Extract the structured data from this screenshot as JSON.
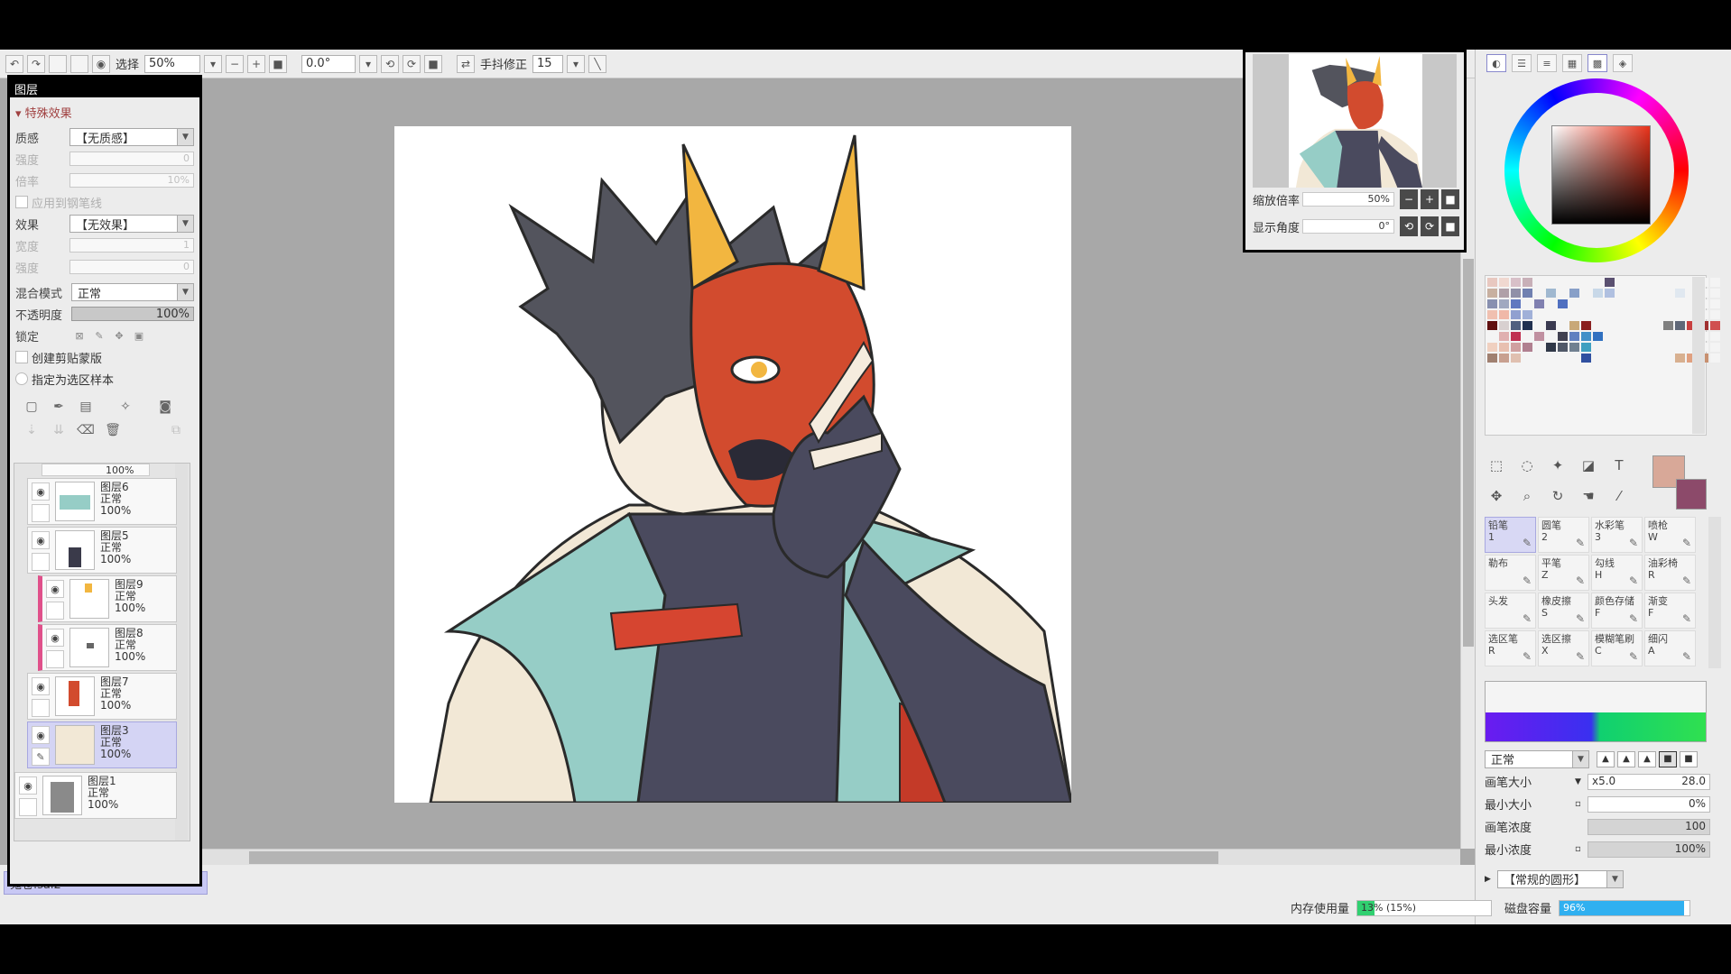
{
  "toolbar": {
    "select_label": "选择",
    "zoom_value": "50%",
    "angle_value": "0.0°",
    "stabilizer_label": "手抖修正",
    "stabilizer_value": "15"
  },
  "layers_panel": {
    "title": "图层",
    "effects_section": "特殊效果",
    "texture_label": "质感",
    "texture_value": "【无质感】",
    "strength_label": "强度",
    "strength_value": "0",
    "scale_label": "倍率",
    "scale_value": "10%",
    "apply_to_pen_label": "应用到钢笔线",
    "effect_label": "效果",
    "effect_value": "【无效果】",
    "width_label": "宽度",
    "width_value": "1",
    "strength2_label": "强度",
    "strength2_value": "0",
    "blend_label": "混合模式",
    "blend_value": "正常",
    "opacity_label": "不透明度",
    "opacity_value": "100%",
    "lock_label": "锁定",
    "clipping_label": "创建剪贴蒙版",
    "selection_source_label": "指定为选区样本",
    "partial_top_value": "100%",
    "layers": [
      {
        "name": "图层6",
        "mode": "正常",
        "opacity": "100%"
      },
      {
        "name": "图层5",
        "mode": "正常",
        "opacity": "100%"
      },
      {
        "name": "图层9",
        "mode": "正常",
        "opacity": "100%"
      },
      {
        "name": "图层8",
        "mode": "正常",
        "opacity": "100%"
      },
      {
        "name": "图层7",
        "mode": "正常",
        "opacity": "100%"
      },
      {
        "name": "图层3",
        "mode": "正常",
        "opacity": "100%"
      },
      {
        "name": "图层1",
        "mode": "正常",
        "opacity": "100%"
      }
    ]
  },
  "file_tab": {
    "name": "鬼苍.sai2",
    "zoom": "50%"
  },
  "navigator": {
    "zoom_label": "缩放倍率",
    "zoom_value": "50%",
    "angle_label": "显示角度",
    "angle_value": "0°"
  },
  "brushes": [
    {
      "name": "铅笔",
      "key": "1"
    },
    {
      "name": "圆笔",
      "key": "2"
    },
    {
      "name": "水彩笔",
      "key": "3"
    },
    {
      "name": "喷枪",
      "key": "W"
    },
    {
      "name": "勒布",
      "key": ""
    },
    {
      "name": "平笔",
      "key": "Z"
    },
    {
      "name": "勾线",
      "key": "H"
    },
    {
      "name": "油彩椅",
      "key": "R"
    },
    {
      "name": "头发",
      "key": ""
    },
    {
      "name": "橡皮擦",
      "key": "S"
    },
    {
      "name": "颜色存储",
      "key": "F"
    },
    {
      "name": "渐变",
      "key": "F"
    },
    {
      "name": "选区笔",
      "key": "R"
    },
    {
      "name": "选区擦",
      "key": "X"
    },
    {
      "name": "模糊笔刷",
      "key": "C"
    },
    {
      "name": "细闪",
      "key": "A"
    }
  ],
  "brush_props": {
    "blend_value": "正常",
    "size_label": "画笔大小",
    "size_mult": "x5.0",
    "size_value": "28.0",
    "min_size_label": "最小大小",
    "min_size_value": "0%",
    "density_label": "画笔浓度",
    "density_value": "100",
    "min_density_label": "最小浓度",
    "min_density_value": "100%",
    "shape_value": "【常规的圆形】"
  },
  "status": {
    "memory_label": "内存使用量",
    "memory_value": "13% (15%)",
    "memory_fraction": 0.13,
    "disk_label": "磁盘容量",
    "disk_value": "96%",
    "disk_fraction": 0.96
  },
  "colors": {
    "fg": "#d8a898",
    "bg": "#8c4a6a",
    "accent": "#c8c8f4"
  }
}
